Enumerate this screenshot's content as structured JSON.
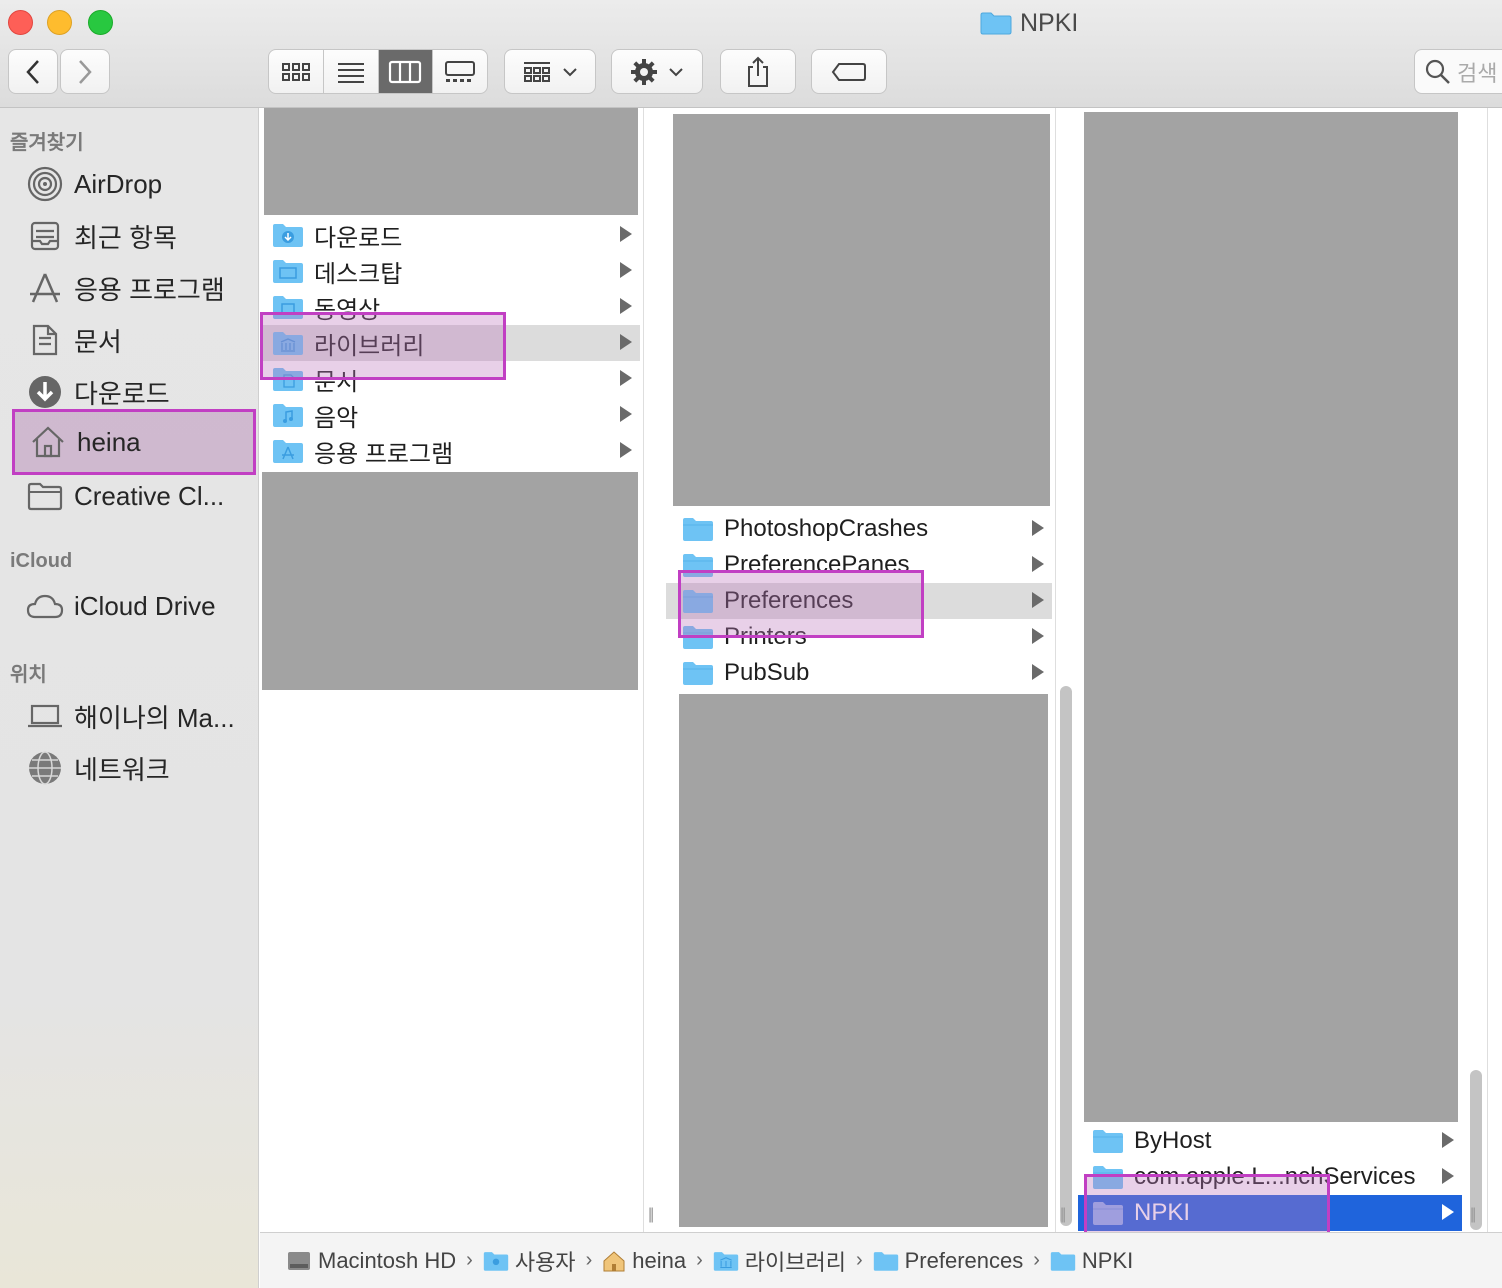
{
  "window": {
    "title": "NPKI"
  },
  "toolbar": {
    "search_placeholder": "검색"
  },
  "sidebar": {
    "favorites_title": "즐겨찾기",
    "favorites": [
      {
        "label": "AirDrop",
        "icon": "airdrop-icon"
      },
      {
        "label": "최근 항목",
        "icon": "recents-icon"
      },
      {
        "label": "응용 프로그램",
        "icon": "applications-icon"
      },
      {
        "label": "문서",
        "icon": "document-icon"
      },
      {
        "label": "다운로드",
        "icon": "download-icon"
      },
      {
        "label": "heina",
        "icon": "home-icon"
      },
      {
        "label": "Creative Cl...",
        "icon": "folder-icon"
      }
    ],
    "icloud_title": "iCloud",
    "icloud": [
      {
        "label": "iCloud Drive",
        "icon": "cloud-icon"
      }
    ],
    "locations_title": "위치",
    "locations": [
      {
        "label": "해이나의 Ma...",
        "icon": "laptop-icon"
      },
      {
        "label": "네트워크",
        "icon": "network-icon"
      }
    ]
  },
  "column1": {
    "items": [
      "다운로드",
      "데스크탑",
      "동영상",
      "라이브러리",
      "문서",
      "음악",
      "응용 프로그램"
    ]
  },
  "column2": {
    "items": [
      "PhotoshopCrashes",
      "PreferencePanes",
      "Preferences",
      "Printers",
      "PubSub"
    ]
  },
  "column3": {
    "items": [
      "ByHost",
      "com.apple.L...nchServices",
      "NPKI"
    ]
  },
  "pathbar": {
    "crumbs": [
      "Macintosh HD",
      "사용자",
      "heina",
      "라이브러리",
      "Preferences",
      "NPKI"
    ],
    "separator": "›"
  },
  "colors": {
    "highlight": "#c13fc3",
    "selection_blue": "#1f64dc",
    "folder_blue": "#6ec3f4"
  }
}
